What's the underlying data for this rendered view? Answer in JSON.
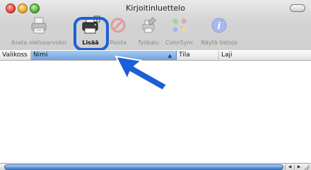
{
  "window": {
    "title": "Kirjoitinluettelo"
  },
  "toolbar": {
    "items": [
      {
        "label": "Aseta oletusarvoksi",
        "icon": "printer-default-icon",
        "enabled": false
      },
      {
        "label": "Lisää",
        "icon": "add-printer-icon",
        "enabled": true,
        "highlighted": true
      },
      {
        "label": "Poista",
        "icon": "delete-icon",
        "enabled": false
      },
      {
        "label": "Työkalu",
        "icon": "utility-icon",
        "enabled": false
      },
      {
        "label": "ColorSync",
        "icon": "colorsync-icon",
        "enabled": false
      },
      {
        "label": "Näytä tietoja",
        "icon": "info-icon",
        "enabled": false
      }
    ]
  },
  "table": {
    "columns": [
      "Valikoss",
      "Nimi",
      "Tila",
      "Laji"
    ],
    "sorted_column": "Nimi",
    "rows": []
  },
  "colors": {
    "highlight": "#1c5fd6",
    "arrow": "#1c5fd6",
    "header_selected": "#6fa2df"
  }
}
